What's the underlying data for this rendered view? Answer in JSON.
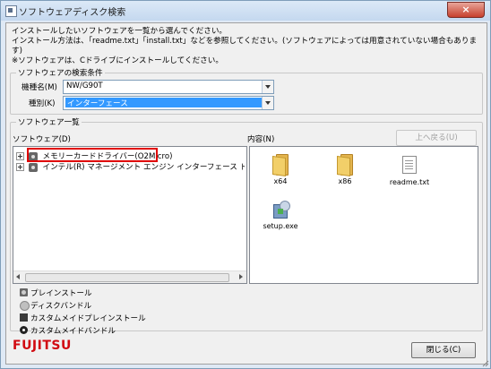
{
  "window": {
    "title": "ソフトウェアディスク検索",
    "close_glyph": "×"
  },
  "intro": {
    "lines": [
      "インストールしたいソフトウェアを一覧から選んでください。",
      "インストール方法は、「readme.txt」「install.txt」などを参照してください。(ソフトウェアによっては用意されていない場合もあります)",
      "※ソフトウェアは、Cドライブにインストールしてください。"
    ]
  },
  "search": {
    "legend": "ソフトウェアの検索条件",
    "model_label": "機種名(M)",
    "model_value": "NW/G90T",
    "category_label": "種別(K)",
    "category_value": "インターフェース"
  },
  "list": {
    "legend": "ソフトウェア一覧",
    "software_label": "ソフトウェア(D)",
    "contents_label": "内容(N)",
    "up_button": "上へ戻る(U)",
    "tree_items": [
      "メモリーカードドライバー(O2Micro)",
      "インテル(R) マネージメント エンジン インターフェース ドライバー(インテル(R"
    ],
    "files": [
      {
        "name": "x64",
        "icon": "folder-icon"
      },
      {
        "name": "x86",
        "icon": "folder-icon"
      },
      {
        "name": "readme.txt",
        "icon": "text-file-icon"
      },
      {
        "name": "setup.exe",
        "icon": "setup-icon"
      }
    ]
  },
  "legend_items": [
    {
      "label": "プレインストール",
      "icon": "preinstall-icon"
    },
    {
      "label": "ディスクバンドル",
      "icon": "disc-bundle-icon"
    },
    {
      "label": "カスタムメイドプレインストール",
      "icon": "custom-preinstall-icon"
    },
    {
      "label": "カスタムメイドバンドル",
      "icon": "custom-bundle-icon"
    }
  ],
  "footer": {
    "logo": "FUJITSU",
    "close_button": "閉じる(C)"
  },
  "colors": {
    "highlight": "#e00000",
    "selection": "#3399ff",
    "brand": "#d10a11"
  }
}
